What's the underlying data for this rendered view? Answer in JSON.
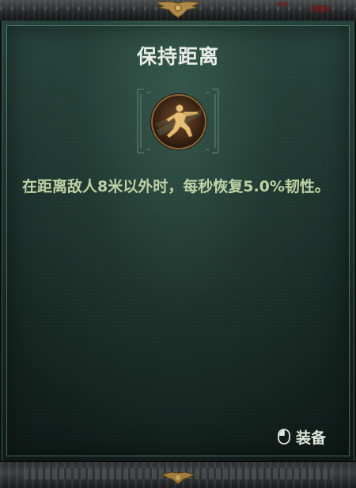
{
  "tooltip": {
    "title": "保持距离",
    "description": "在距离敌人8米以外时，每秒恢复5.0%韧性。",
    "icon": "running-soldier-icon",
    "equip_label": "装备",
    "equip_icon": "mouse-icon"
  },
  "colors": {
    "panel_top": "#26423a",
    "panel_bottom": "#0f1a17",
    "title": "#e8ece6",
    "description": "#bfd2a6",
    "icon_gold": "#e6c079",
    "frame": "#7aa896"
  }
}
